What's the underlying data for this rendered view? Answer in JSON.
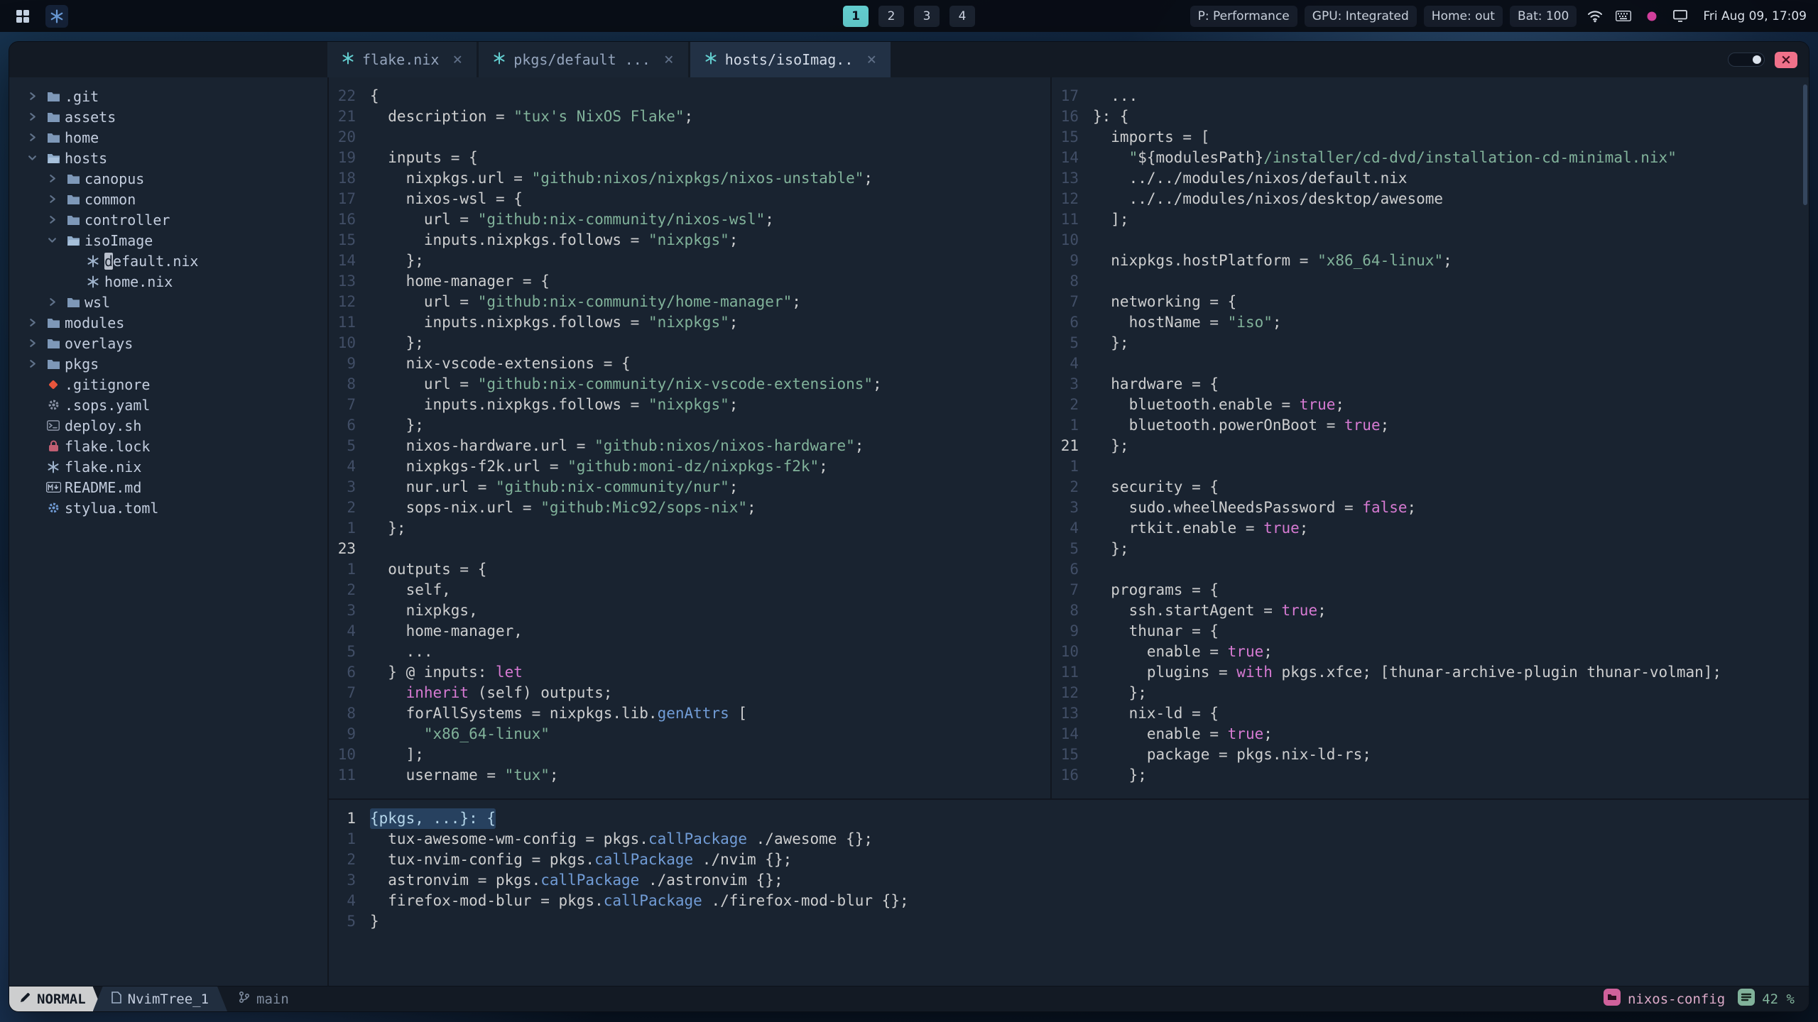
{
  "topbar": {
    "launcher_icons": [
      "app-grid-icon",
      "nixos-logo-icon"
    ],
    "workspaces": [
      "1",
      "2",
      "3",
      "4"
    ],
    "active_workspace": "1",
    "status_items": [
      "P: Performance",
      "GPU: Integrated",
      "Home: out",
      "Bat: 100"
    ],
    "tray_icons": [
      "wifi-icon",
      "keyboard-icon",
      "color-dot-icon",
      "display-icon"
    ],
    "clock": "Fri Aug 09, 17:09"
  },
  "window": {
    "tabs": [
      {
        "label": "flake.nix",
        "icon": "nix-icon",
        "close": "×",
        "active": false
      },
      {
        "label": "pkgs/default ...",
        "icon": "nix-icon",
        "close": "×",
        "active": false
      },
      {
        "label": "hosts/isoImag..",
        "icon": "nix-icon",
        "close": "×",
        "active": true
      }
    ],
    "titlebar": {
      "toggle_icon": "toggle-pill-icon",
      "close_icon": "window-close-icon",
      "close_glyph": "×"
    },
    "tree": {
      "items": [
        {
          "label": ".git",
          "depth": 0,
          "kind": "folder",
          "arrow": "closed"
        },
        {
          "label": "assets",
          "depth": 0,
          "kind": "folder",
          "arrow": "closed"
        },
        {
          "label": "home",
          "depth": 0,
          "kind": "folder",
          "arrow": "closed"
        },
        {
          "label": "hosts",
          "depth": 0,
          "kind": "folder-open",
          "arrow": "open"
        },
        {
          "label": "canopus",
          "depth": 1,
          "kind": "folder",
          "arrow": "closed"
        },
        {
          "label": "common",
          "depth": 1,
          "kind": "folder",
          "arrow": "closed"
        },
        {
          "label": "controller",
          "depth": 1,
          "kind": "folder",
          "arrow": "closed"
        },
        {
          "label": "isoImage",
          "depth": 1,
          "kind": "folder-open",
          "arrow": "open"
        },
        {
          "label": "default.nix",
          "depth": 2,
          "kind": "nix",
          "cursor": true
        },
        {
          "label": "home.nix",
          "depth": 2,
          "kind": "nix"
        },
        {
          "label": "wsl",
          "depth": 1,
          "kind": "folder",
          "arrow": "closed"
        },
        {
          "label": "modules",
          "depth": 0,
          "kind": "folder",
          "arrow": "closed"
        },
        {
          "label": "overlays",
          "depth": 0,
          "kind": "folder",
          "arrow": "closed"
        },
        {
          "label": "pkgs",
          "depth": 0,
          "kind": "folder",
          "arrow": "closed"
        },
        {
          "label": ".gitignore",
          "depth": 0,
          "kind": "git"
        },
        {
          "label": ".sops.yaml",
          "depth": 0,
          "kind": "gear"
        },
        {
          "label": "deploy.sh",
          "depth": 0,
          "kind": "shell"
        },
        {
          "label": "flake.lock",
          "depth": 0,
          "kind": "lock"
        },
        {
          "label": "flake.nix",
          "depth": 0,
          "kind": "nix"
        },
        {
          "label": "README.md",
          "depth": 0,
          "kind": "markdown"
        },
        {
          "label": "stylua.toml",
          "depth": 0,
          "kind": "gear-blue"
        }
      ]
    },
    "panes": {
      "flake": {
        "lines": [
          [
            "22",
            "{"
          ],
          [
            "21",
            "  description = \"tux's NixOS Flake\";"
          ],
          [
            "20",
            ""
          ],
          [
            "19",
            "  inputs = {"
          ],
          [
            "18",
            "    nixpkgs.url = \"github:nixos/nixpkgs/nixos-unstable\";"
          ],
          [
            "17",
            "    nixos-wsl = {"
          ],
          [
            "16",
            "      url = \"github:nix-community/nixos-wsl\";"
          ],
          [
            "15",
            "      inputs.nixpkgs.follows = \"nixpkgs\";"
          ],
          [
            "14",
            "    };"
          ],
          [
            "13",
            "    home-manager = {"
          ],
          [
            "12",
            "      url = \"github:nix-community/home-manager\";"
          ],
          [
            "11",
            "      inputs.nixpkgs.follows = \"nixpkgs\";"
          ],
          [
            "10",
            "    };"
          ],
          [
            "9",
            "    nix-vscode-extensions = {"
          ],
          [
            "8",
            "      url = \"github:nix-community/nix-vscode-extensions\";"
          ],
          [
            "7",
            "      inputs.nixpkgs.follows = \"nixpkgs\";"
          ],
          [
            "6",
            "    };"
          ],
          [
            "5",
            "    nixos-hardware.url = \"github:nixos/nixos-hardware\";"
          ],
          [
            "4",
            "    nixpkgs-f2k.url = \"github:moni-dz/nixpkgs-f2k\";"
          ],
          [
            "3",
            "    nur.url = \"github:nix-community/nur\";"
          ],
          [
            "2",
            "    sops-nix.url = \"github:Mic92/sops-nix\";"
          ],
          [
            "1",
            "  };"
          ],
          [
            "23",
            "",
            "c"
          ],
          [
            "1",
            "  outputs = {"
          ],
          [
            "2",
            "    self,"
          ],
          [
            "3",
            "    nixpkgs,"
          ],
          [
            "4",
            "    home-manager,"
          ],
          [
            "5",
            "    ..."
          ],
          [
            "6",
            "  } @ inputs: let"
          ],
          [
            "7",
            "    inherit (self) outputs;"
          ],
          [
            "8",
            "    forAllSystems = nixpkgs.lib.genAttrs ["
          ],
          [
            "9",
            "      \"x86_64-linux\""
          ],
          [
            "10",
            "    ];"
          ],
          [
            "11",
            "    username = \"tux\";"
          ]
        ]
      },
      "iso": {
        "lines": [
          [
            "17",
            "  ..."
          ],
          [
            "16",
            "}: {"
          ],
          [
            "15",
            "  imports = ["
          ],
          [
            "14",
            "    \"${modulesPath}/installer/cd-dvd/installation-cd-minimal.nix\""
          ],
          [
            "13",
            "    ../../modules/nixos/default.nix"
          ],
          [
            "12",
            "    ../../modules/nixos/desktop/awesome"
          ],
          [
            "11",
            "  ];"
          ],
          [
            "10",
            ""
          ],
          [
            "9",
            "  nixpkgs.hostPlatform = \"x86_64-linux\";"
          ],
          [
            "8",
            ""
          ],
          [
            "7",
            "  networking = {"
          ],
          [
            "6",
            "    hostName = \"iso\";"
          ],
          [
            "5",
            "  };"
          ],
          [
            "4",
            ""
          ],
          [
            "3",
            "  hardware = {"
          ],
          [
            "2",
            "    bluetooth.enable = true;"
          ],
          [
            "1",
            "    bluetooth.powerOnBoot = true;"
          ],
          [
            "21",
            "  };",
            "c"
          ],
          [
            "1",
            ""
          ],
          [
            "2",
            "  security = {"
          ],
          [
            "3",
            "    sudo.wheelNeedsPassword = false;"
          ],
          [
            "4",
            "    rtkit.enable = true;"
          ],
          [
            "5",
            "  };"
          ],
          [
            "6",
            ""
          ],
          [
            "7",
            "  programs = {"
          ],
          [
            "8",
            "    ssh.startAgent = true;"
          ],
          [
            "9",
            "    thunar = {"
          ],
          [
            "10",
            "      enable = true;"
          ],
          [
            "11",
            "      plugins = with pkgs.xfce; [thunar-archive-plugin thunar-volman];"
          ],
          [
            "12",
            "    };"
          ],
          [
            "13",
            "    nix-ld = {"
          ],
          [
            "14",
            "      enable = true;"
          ],
          [
            "15",
            "      package = pkgs.nix-ld-rs;"
          ],
          [
            "16",
            "    };"
          ]
        ]
      },
      "pkgs": {
        "lines": [
          [
            "1",
            "{pkgs, ...}: {",
            "ch"
          ],
          [
            "1",
            "  tux-awesome-wm-config = pkgs.callPackage ./awesome {};"
          ],
          [
            "2",
            "  tux-nvim-config = pkgs.callPackage ./nvim {};"
          ],
          [
            "3",
            "  astronvim = pkgs.callPackage ./astronvim {};"
          ],
          [
            "4",
            "  firefox-mod-blur = pkgs.callPackage ./firefox-mod-blur {};"
          ],
          [
            "5",
            "}"
          ]
        ]
      }
    },
    "statusline": {
      "mode": "NORMAL",
      "mode_icon": "pencil-icon",
      "buffer": "NvimTree_1",
      "buffer_icon": "file-icon",
      "branch_icon": "git-branch-icon",
      "branch": "main",
      "project_icon": "folder-badge-icon",
      "project": "nixos-config",
      "scroll_icon": "list-badge-icon",
      "scroll": "42 %"
    }
  },
  "colors": {
    "accent_teal": "#63cdcf",
    "string_green": "#81b29a",
    "keyword_pink": "#d67ad2",
    "function_blue": "#719cd6",
    "close_button_red": "#f0718a",
    "project_pink": "#d0619b",
    "editor_bg": "#192330",
    "tabline_bg": "#131a24"
  }
}
